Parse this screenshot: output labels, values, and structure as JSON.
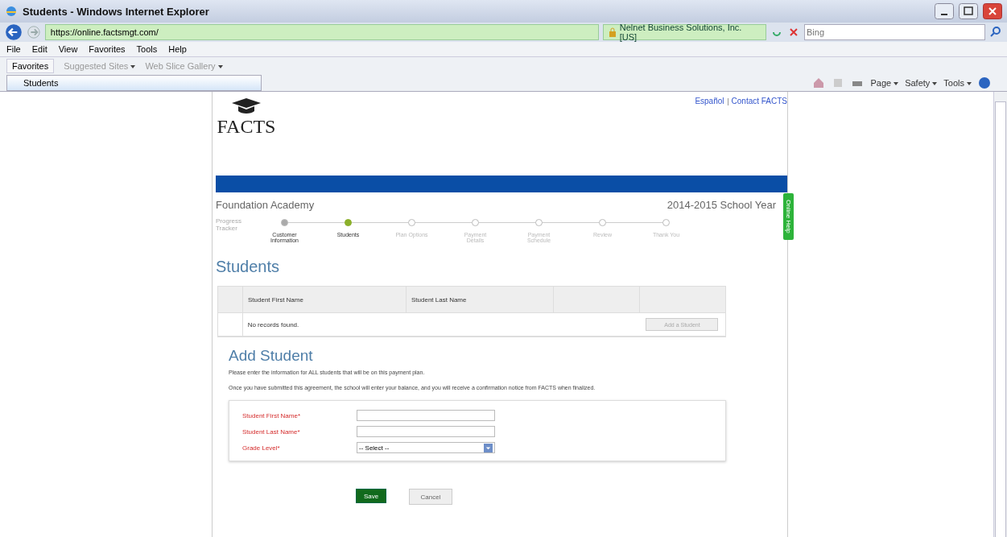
{
  "window": {
    "title": "Students - Windows Internet Explorer"
  },
  "address_bar": {
    "url": "https://online.factsmgt.com/",
    "security": "Nelnet Business Solutions, Inc. [US]",
    "search_placeholder": "Bing"
  },
  "menu": [
    "File",
    "Edit",
    "View",
    "Favorites",
    "Tools",
    "Help"
  ],
  "favorites_bar": {
    "favorites": "Favorites",
    "links": [
      "Suggested Sites",
      "Web Slice Gallery"
    ]
  },
  "tab": {
    "title": "Students"
  },
  "command_bar": [
    "Page",
    "Safety",
    "Tools"
  ],
  "page": {
    "links": [
      "Español",
      "Contact FACTS"
    ],
    "logo": "FACTS",
    "school": "Foundation Academy",
    "year": "2014-2015 School Year",
    "side_tab": "Online Help",
    "progress": {
      "label": "Progress Tracker",
      "steps": [
        {
          "label": "Customer Information",
          "done": true,
          "selected": false
        },
        {
          "label": "Students",
          "done": false,
          "selected": true
        },
        {
          "label": "Plan Options",
          "done": false,
          "selected": false
        },
        {
          "label": "Payment Details",
          "done": false,
          "selected": false
        },
        {
          "label": "Payment Schedule",
          "done": false,
          "selected": false
        },
        {
          "label": "Review",
          "done": false,
          "selected": false
        },
        {
          "label": "Thank You",
          "done": false,
          "selected": false
        }
      ]
    },
    "heading": "Students",
    "table": {
      "columns": [
        "Student First Name",
        "Student Last Name"
      ],
      "empty": "No records found.",
      "add_button": "Add a Student"
    },
    "add_heading": "Add Student",
    "paragraphs": [
      "Please enter the information for ALL students that will be on this payment plan.",
      "Once you have submitted this agreement, the school will enter your balance, and you will receive a confirmation notice from FACTS when finalized."
    ],
    "form": [
      {
        "label": "Student First Name*",
        "kind": "text"
      },
      {
        "label": "Student Last Name*",
        "kind": "text"
      },
      {
        "label": "Grade Level*",
        "kind": "select",
        "value": "-- Select --"
      }
    ],
    "buttons": {
      "save": "Save",
      "cancel": "Cancel"
    }
  }
}
